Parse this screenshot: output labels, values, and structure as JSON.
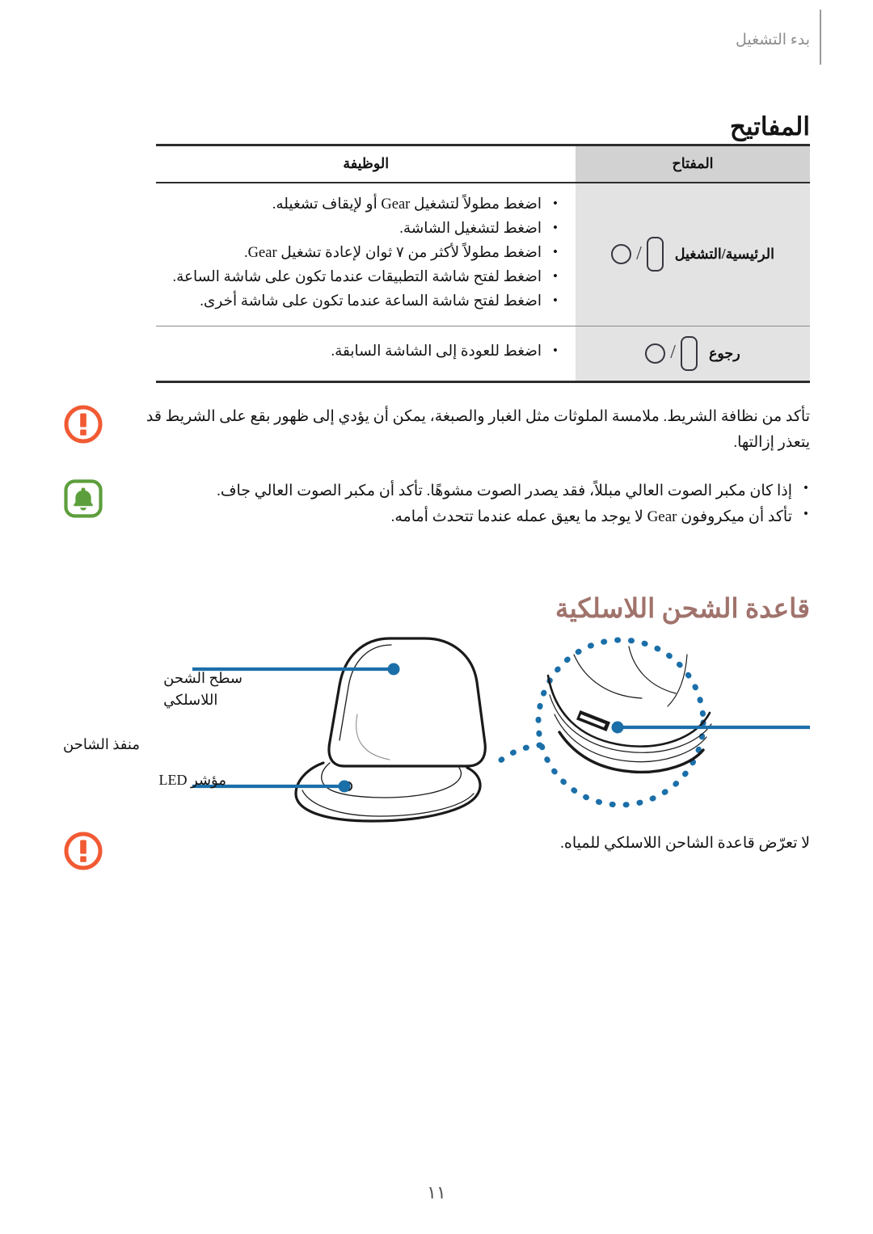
{
  "document": {
    "running_header": "بدء التشغيل",
    "page_number": "١١"
  },
  "keys_section": {
    "title": "المفاتيح",
    "table": {
      "headers": {
        "key": "المفتاح",
        "function": "الوظيفة"
      },
      "rows": [
        {
          "key_label": "الرئيسية/التشغيل",
          "key_icons": [
            "rounded-button-icon",
            "slash-separator",
            "circle-button-icon"
          ],
          "functions": [
            "اضغط مطولاً لتشغيل Gear أو لإيقاف تشغيله.",
            "اضغط لتشغيل الشاشة.",
            "اضغط مطولاً لأكثر من ٧ ثوان لإعادة تشغيل Gear.",
            "اضغط لفتح شاشة التطبيقات عندما تكون على شاشة الساعة.",
            "اضغط لفتح شاشة الساعة عندما تكون على شاشة أخرى."
          ]
        },
        {
          "key_label": "رجوع",
          "key_icons": [
            "rounded-button-icon",
            "slash-separator",
            "circle-button-icon"
          ],
          "functions": [
            "اضغط للعودة إلى الشاشة السابقة."
          ]
        }
      ]
    }
  },
  "notes": {
    "caution_strap": {
      "icon": "caution-icon",
      "icon_color": "#f15a33",
      "text": "تأكد من نظافة الشريط. ملامسة الملوثات مثل الغبار والصبغة، يمكن أن يؤدي إلى ظهور بقع على الشريط قد يتعذر إزالتها."
    },
    "info_audio": {
      "icon": "bell-icon",
      "icon_color": "#5d9e3c",
      "items": [
        "إذا كان مكبر الصوت العالي مبللاً، فقد يصدر الصوت مشوهًا. تأكد أن مكبر الصوت العالي جاف.",
        "تأكد أن ميكروفون Gear لا يوجد ما يعيق عمله عندما تتحدث أمامه."
      ]
    },
    "caution_water": {
      "icon": "caution-icon",
      "icon_color": "#f15a33",
      "text": "لا تعرّض قاعدة الشاحن اللاسلكي للمياه."
    }
  },
  "wireless_charger_section": {
    "title": "قاعدة الشحن اللاسلكية",
    "title_color": "#a0736c",
    "callout_color": "#1b6fa8",
    "labels": {
      "charging_surface_line1": "سطح الشحن",
      "charging_surface_line2": "اللاسلكي",
      "led_indicator": "مؤشر LED",
      "charger_port": "منفذ الشاحن"
    },
    "diagram_name": "wireless-charging-dock-diagram"
  }
}
